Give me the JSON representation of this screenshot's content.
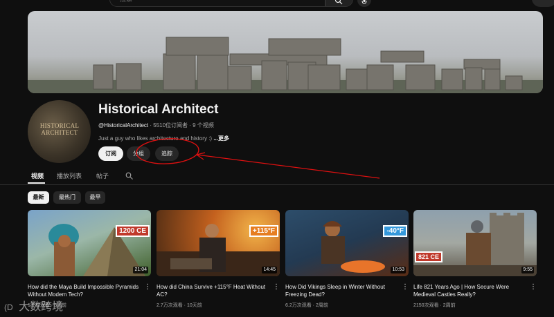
{
  "search": {
    "placeholder": "搜索"
  },
  "channel": {
    "avatar_text": "HISTORICAL ARCHITECT",
    "name": "Historical Architect",
    "handle": "@HistoricalArchitect",
    "stats": "· 5510位订阅者 · 9 个视频",
    "description": "Just a guy who likes architecture and history :)",
    "more_label": "...更多"
  },
  "buttons": {
    "subscribe": "订阅",
    "group": "分组",
    "track": "追踪"
  },
  "tabs": [
    "视频",
    "播放列表",
    "帖子"
  ],
  "chips": [
    "最新",
    "最热门",
    "最早"
  ],
  "videos": [
    {
      "badge": "1200 CE",
      "badge_color": "#c0392b",
      "duration": "21:04",
      "title": "How did the Maya Build Impossible Pyramids Without Modern Tech?",
      "meta": "1天前观看 · 3天前"
    },
    {
      "badge": "+115°F",
      "badge_color": "#e67e22",
      "duration": "14:45",
      "title": "How did China Survive +115°F Heat Without AC?",
      "meta": "2.7万次观看 · 10天前"
    },
    {
      "badge": "-40°F",
      "badge_color": "#3498db",
      "duration": "10:53",
      "title": "How Did Vikings Sleep in Winter Without Freezing Dead?",
      "meta": "6.2万次观看 · 2周前"
    },
    {
      "badge": "821 CE",
      "badge_color": "#c0392b",
      "duration": "9:55",
      "title": "Life 821 Years Ago | How Secure Were Medieval Castles Really?",
      "meta": "2150次观看 · 2周前"
    }
  ],
  "watermark": {
    "logo": "(D",
    "text": "大数跨境"
  },
  "colors": {
    "background": "#0f0f0f",
    "chip_active": "#f1f1f1",
    "chip": "#272727",
    "annotation": "#e01010"
  }
}
